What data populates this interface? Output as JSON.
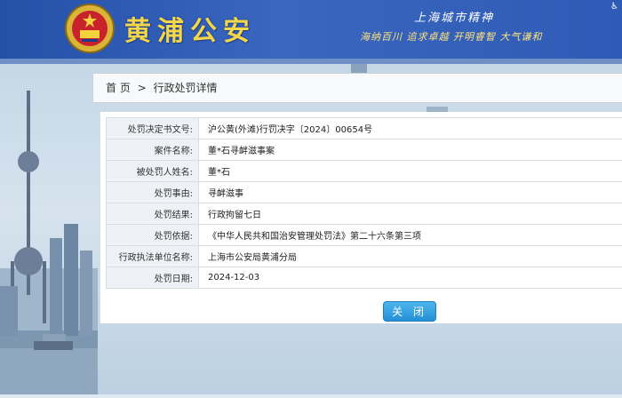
{
  "header": {
    "site_title": "黄浦公安",
    "spirit_title": "上海城市精神",
    "spirit_sub": "海纳百川  追求卓越  开明睿智  大气谦和",
    "corner_icon": "accessibility-icon"
  },
  "breadcrumb": {
    "home": "首 页",
    "separator": ">",
    "current": "行政处罚详情"
  },
  "details": [
    {
      "label": "处罚决定书文号:",
      "value": "沪公黄(外滩)行罚决字〔2024〕00654号"
    },
    {
      "label": "案件名称:",
      "value": "董*石寻衅滋事案"
    },
    {
      "label": "被处罚人姓名:",
      "value": "董*石"
    },
    {
      "label": "处罚事由:",
      "value": "寻衅滋事"
    },
    {
      "label": "处罚结果:",
      "value": "行政拘留七日"
    },
    {
      "label": "处罚依据:",
      "value": "《中华人民共和国治安管理处罚法》第二十六条第三项"
    },
    {
      "label": "行政执法单位名称:",
      "value": "上海市公安局黄浦分局"
    },
    {
      "label": "处罚日期:",
      "value": "2024-12-03"
    }
  ],
  "close_label": "关 闭",
  "colors": {
    "header_blue": "#2e5bb5",
    "title_gold": "#f4d64a",
    "button_blue": "#2590d6"
  }
}
